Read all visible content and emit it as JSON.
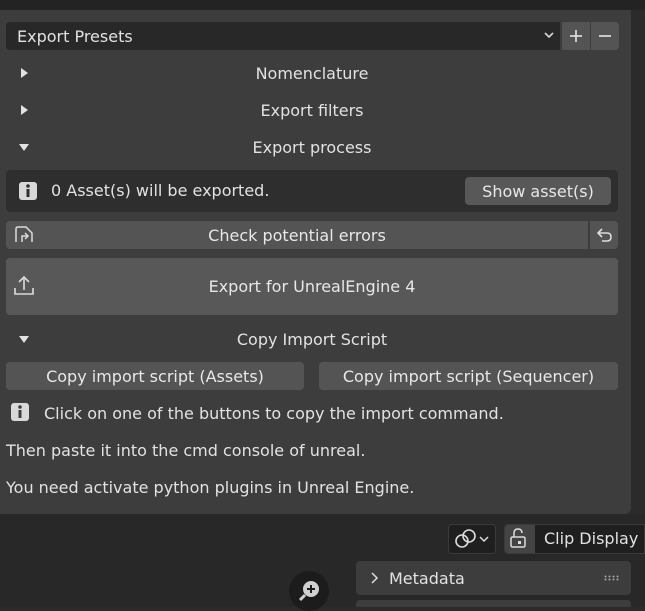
{
  "export_presets": {
    "label": "Export Presets",
    "add_label": "+",
    "remove_label": "−"
  },
  "sections": {
    "nomenclature": "Nomenclature",
    "export_filters": "Export filters",
    "export_process": "Export process",
    "copy_import_script": "Copy Import Script"
  },
  "export_process": {
    "assets_info": "0 Asset(s) will be exported.",
    "show_assets_label": "Show asset(s)",
    "check_errors_label": "Check potential errors",
    "export_label": "Export for UnrealEngine 4"
  },
  "copy_import": {
    "assets_button": "Copy import script (Assets)",
    "sequencer_button": "Copy import script (Sequencer)",
    "info_line": "Click on one of the buttons to copy the import command.",
    "line2": "Then paste it into the cmd console of unreal.",
    "line3": "You need activate python plugins in Unreal Engine."
  },
  "lower_header": {
    "clip_display_label": "Clip Display"
  },
  "metadata_panel": {
    "label": "Metadata"
  },
  "colors": {
    "panel_bg": "#3d3d3d",
    "button_bg": "#545454",
    "field_bg": "#282828",
    "text": "#e2e2e2"
  }
}
